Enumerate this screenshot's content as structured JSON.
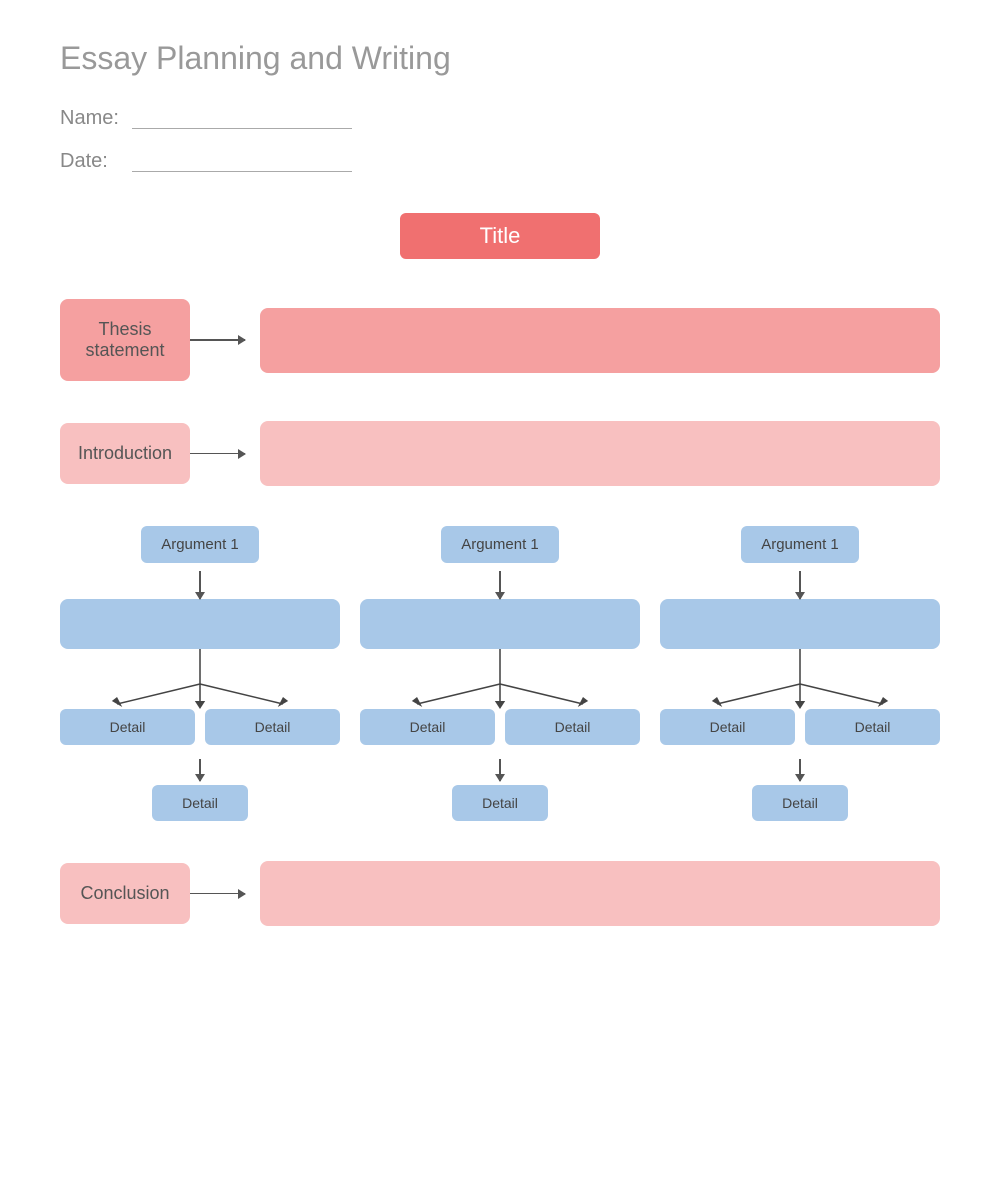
{
  "page": {
    "title": "Essay Planning and Writing",
    "name_label": "Name:",
    "date_label": "Date:"
  },
  "title_box": {
    "label": "Title"
  },
  "thesis": {
    "label": "Thesis statement"
  },
  "introduction": {
    "label": "Introduction"
  },
  "conclusion": {
    "label": "Conclusion"
  },
  "arguments": [
    {
      "label": "Argument 1",
      "details": [
        "Detail",
        "Detail"
      ],
      "detail_bottom": "Detail"
    },
    {
      "label": "Argument 1",
      "details": [
        "Detail",
        "Detail"
      ],
      "detail_bottom": "Detail"
    },
    {
      "label": "Argument 1",
      "details": [
        "Detail",
        "Detail"
      ],
      "detail_bottom": "Detail"
    }
  ]
}
